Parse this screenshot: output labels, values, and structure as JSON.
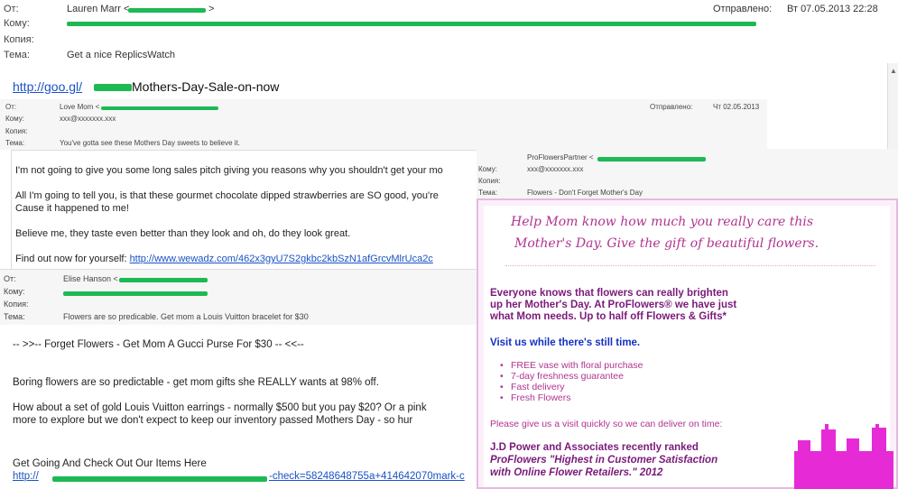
{
  "main_header": {
    "from_label": "От:",
    "from_value": "Lauren Marr <",
    "from_value_end": ">",
    "to_label": "Кому:",
    "cc_label": "Копия:",
    "subject_label": "Тема:",
    "subject_value": "Get a nice ReplicsWatch",
    "sent_label": "Отправлено:",
    "sent_value": "Вт 07.05.2013 22:28"
  },
  "main_body": {
    "link_text": "http://goo.gl/",
    "link_tail": "Mothers-Day-Sale-on-now"
  },
  "shot1": {
    "from_label": "От:",
    "from_value": "Love Mom <",
    "to_label": "Кому:",
    "to_value": "xxx@xxxxxxx.xxx",
    "cc_label": "Копия:",
    "subject_label": "Тема:",
    "subject_value": "You've gotta see these Mothers Day sweets to believe it.",
    "sent_label": "Отправлено:",
    "sent_value": "Чт 02.05.2013",
    "p1": "I'm not going to give you some long sales pitch giving you reasons why you shouldn't get your mo",
    "p2a": "All I'm going to tell you, is that these gourmet chocolate dipped strawberries are SO good, you're",
    "p2b": "Cause it happened to me!",
    "p3": "Believe me, they taste even better than they look and oh, do they look great.",
    "p4_prefix": "Find out now for yourself: ",
    "p4_link": "http://www.wewadz.com/462x3gyU7S2gkbc2kbSzN1afGrcvMlrUca2c"
  },
  "shot2": {
    "from_value": "ProFlowersPartner <",
    "to_label": "Кому:",
    "to_value": "xxx@xxxxxxx.xxx",
    "cc_label": "Копия:",
    "subject_label": "Тема:",
    "subject_value": "Flowers - Don't Forget Mother's Day",
    "headline1": "Help Mom know how much you really care this",
    "headline2": "Mother's Day. Give the gift of beautiful flowers.",
    "para1a": "Everyone knows that flowers can really brighten",
    "para1b": "up her Mother's Day. At ProFlowers® we have just",
    "para1c": "what Mom needs. Up to half off Flowers & Gifts*",
    "visit": "Visit us while there's still time.",
    "bullets": [
      "FREE vase with floral purchase",
      "7-day freshness guarantee",
      "Fast delivery",
      "Fresh Flowers"
    ],
    "please": "Please give us a visit quickly so we can deliver on time:",
    "jd1": "J.D Power and Associates recently ranked",
    "jd2": "ProFlowers \"Highest in Customer Satisfaction",
    "jd3": "with Online Flower Retailers.\" 2012"
  },
  "shot3": {
    "from_label": "От:",
    "from_value": "Elise Hanson <",
    "to_label": "Кому:",
    "cc_label": "Копия:",
    "subject_label": "Тема:",
    "subject_value": "Flowers are so predicable.  Get mom a Louis Vuitton bracelet for $30",
    "line1": "-- >>-- Forget Flowers - Get Mom A Gucci Purse For $30 -- <<--",
    "line2": "Boring flowers are so predictable - get mom gifts she REALLY wants at 98% off.",
    "line3a": "How about a set of gold Louis Vuitton earrings - normally $500 but you pay $20?  Or a pink",
    "line3b": "more to explore but we don't expect to keep our inventory passed Mothers Day - so hur",
    "line4": "Get Going And Check Out Our Items Here",
    "link_prefix": "http://",
    "link_suffix": "-check=58248648755a+414642070mark-c"
  },
  "colors": {
    "link": "#1a52c4",
    "redaction": "#1db954",
    "flower_pink": "#b0348f",
    "flower_magenta": "#e62ad6",
    "flower_bold": "#7a1a7a",
    "flower_blue": "#1330c2"
  }
}
